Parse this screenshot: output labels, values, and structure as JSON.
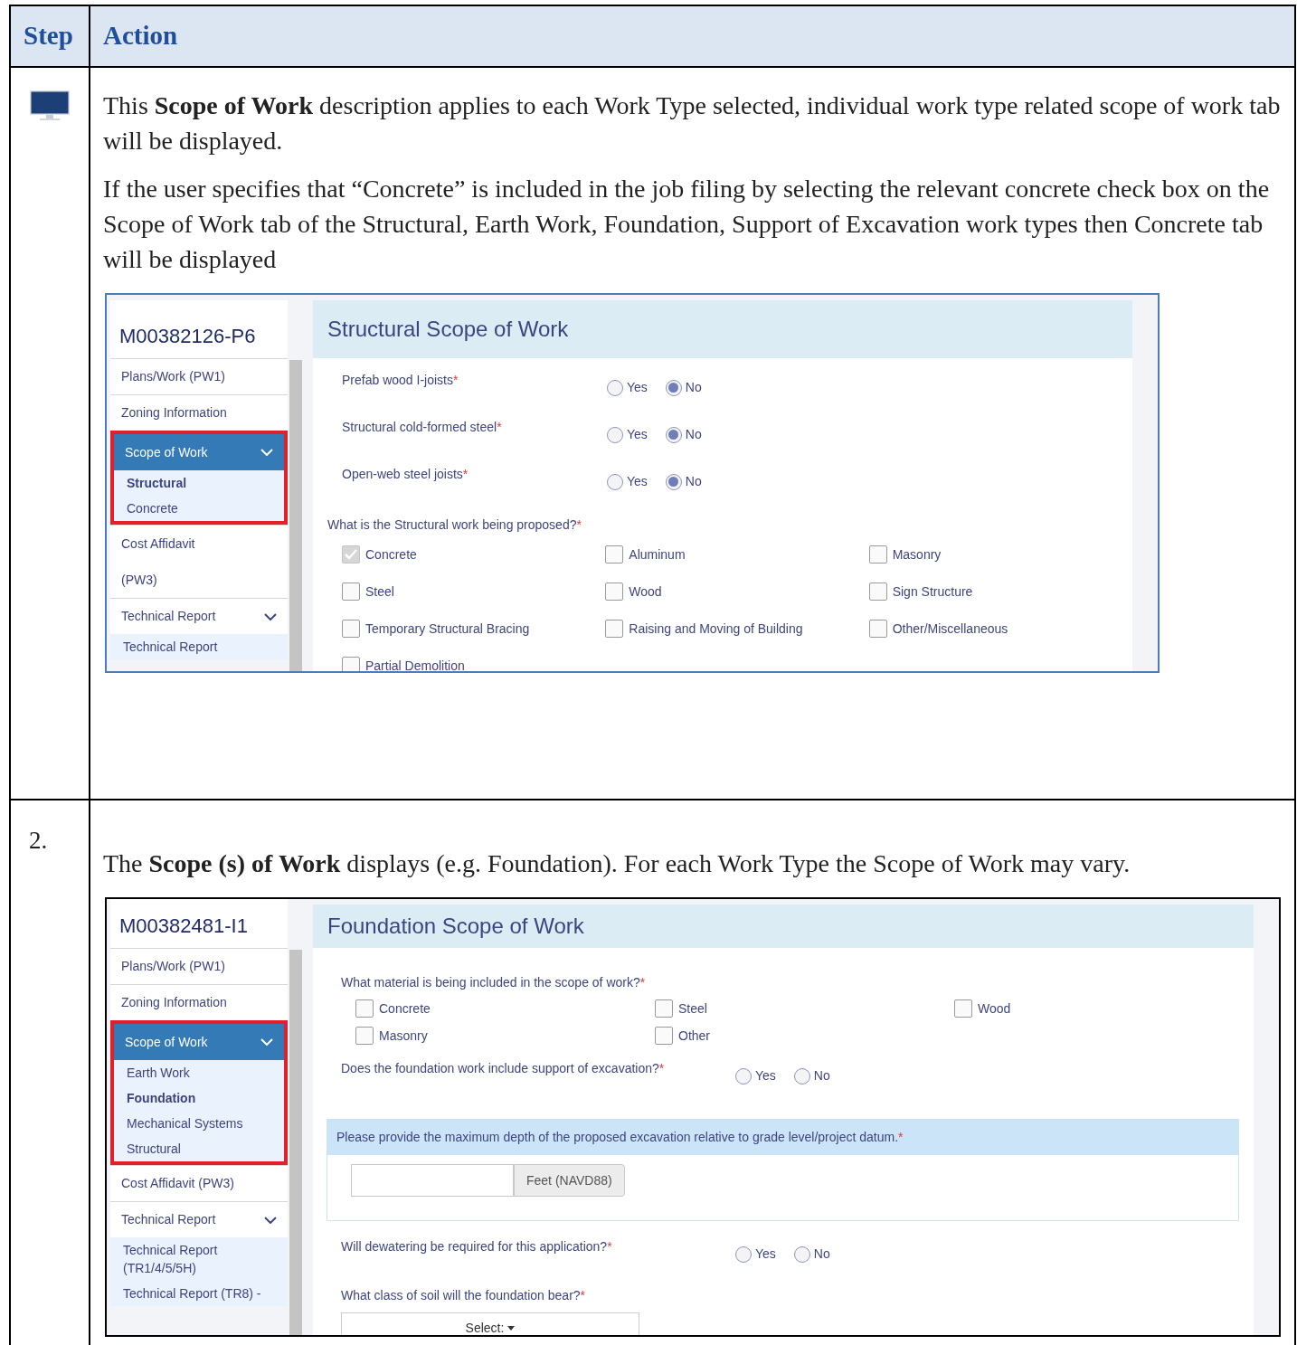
{
  "table": {
    "columns": [
      "Step",
      "Action"
    ],
    "rows": [
      {
        "paragraphs": [
          "This **Scope of Work** description applies to each Work Type selected, individual work type related scope of work tab will be displayed.",
          "If the user specifies that “Concrete” is included in the job filing by selecting the relevant concrete check box on the Scope of Work tab of the Structural, Earth Work, Foundation, Support of Excavation work types then Concrete tab will be displayed"
        ],
        "screenshot": {
          "record": "M00382126-P6",
          "nav": [
            {
              "lines": [
                "Plans/Work (PW1)"
              ],
              "selected": false,
              "expanded": false,
              "highlighted": false
            },
            {
              "lines": [
                "Zoning Information"
              ],
              "selected": false,
              "expanded": false,
              "highlighted": false
            },
            {
              "lines": [
                "Scope of Work"
              ],
              "selected": true,
              "expanded": true,
              "highlighted": true,
              "children": [
                {
                  "lines": [
                    "Structural"
                  ],
                  "selected": true
                },
                {
                  "lines": [
                    "Concrete"
                  ],
                  "selected": false
                }
              ]
            },
            {
              "lines": [
                "Cost Affidavit",
                "(PW3)"
              ],
              "selected": false,
              "expanded": false,
              "highlighted": false
            },
            {
              "lines": [
                "Technical Report"
              ],
              "selected": false,
              "expanded": true,
              "highlighted": false,
              "children": [
                {
                  "lines": [
                    "Technical Report"
                  ],
                  "selected": false
                }
              ]
            }
          ],
          "form": {
            "title": "Structural Scope of Work",
            "fields": [
              {
                "kind": "radio",
                "label": "Prefab wood I-joists",
                "mark": "*",
                "options": [
                  {
                    "label": "Yes",
                    "selected": false
                  },
                  {
                    "label": "No",
                    "selected": true
                  }
                ]
              },
              {
                "kind": "radio",
                "label": "Structural cold-formed steel",
                "mark": "*",
                "options": [
                  {
                    "label": "Yes",
                    "selected": false
                  },
                  {
                    "label": "No",
                    "selected": true
                  }
                ]
              },
              {
                "kind": "radio",
                "label": "Open-web steel joists",
                "mark": "*",
                "options": [
                  {
                    "label": "Yes",
                    "selected": false
                  },
                  {
                    "label": "No",
                    "selected": true
                  }
                ]
              },
              {
                "kind": "checks",
                "label": "What is the Structural work being proposed?",
                "mark": "*",
                "options": [
                  {
                    "label": "Concrete",
                    "checked": true
                  },
                  {
                    "label": "Aluminum",
                    "checked": false
                  },
                  {
                    "label": "Masonry",
                    "checked": false
                  },
                  {
                    "label": "Steel",
                    "checked": false
                  },
                  {
                    "label": "Wood",
                    "checked": false
                  },
                  {
                    "label": "Sign Structure",
                    "checked": false
                  },
                  {
                    "label": "Temporary Structural Bracing",
                    "checked": false
                  },
                  {
                    "label": "Raising and Moving of Building",
                    "checked": false
                  },
                  {
                    "label": "Other/Miscellaneous",
                    "checked": false
                  },
                  {
                    "label": "Partial Demolition",
                    "checked": false
                  }
                ]
              }
            ]
          }
        }
      },
      {
        "step": "2.",
        "paragraphs": [
          "The **Scope (s) of Work** displays (e.g. Foundation). For each Work Type the Scope of Work may vary."
        ],
        "screenshot": {
          "record": "M00382481-I1",
          "nav": [
            {
              "lines": [
                "Plans/Work (PW1)"
              ],
              "selected": false,
              "expanded": false,
              "highlighted": false
            },
            {
              "lines": [
                "Zoning Information"
              ],
              "selected": false,
              "expanded": false,
              "highlighted": false
            },
            {
              "lines": [
                "Scope of Work"
              ],
              "selected": true,
              "expanded": true,
              "highlighted": true,
              "children": [
                {
                  "lines": [
                    "Earth Work"
                  ],
                  "selected": false
                },
                {
                  "lines": [
                    "Foundation"
                  ],
                  "selected": true
                },
                {
                  "lines": [
                    "Mechanical Systems"
                  ],
                  "selected": false
                },
                {
                  "lines": [
                    "Structural"
                  ],
                  "selected": false
                }
              ]
            },
            {
              "lines": [
                "Cost Affidavit (PW3)"
              ],
              "selected": false,
              "expanded": false,
              "highlighted": false
            },
            {
              "lines": [
                "Technical Report"
              ],
              "selected": false,
              "expanded": true,
              "highlighted": false,
              "children": [
                {
                  "lines": [
                    "Technical Report",
                    "(TR1/4/5/5H)"
                  ],
                  "selected": false
                },
                {
                  "lines": [
                    "Technical Report (TR8) -"
                  ],
                  "selected": false
                }
              ]
            }
          ],
          "form": {
            "title": "Foundation Scope of Work",
            "fields": [
              {
                "kind": "checks",
                "label": "What material is being included in the scope of work?",
                "mark": "*",
                "options": [
                  {
                    "label": "Concrete",
                    "checked": false
                  },
                  {
                    "label": "Steel",
                    "checked": false
                  },
                  {
                    "label": "Wood",
                    "checked": false
                  },
                  {
                    "label": "Masonry",
                    "checked": false
                  },
                  {
                    "label": "Other",
                    "checked": false
                  }
                ]
              },
              {
                "kind": "radio",
                "label": "Does the foundation work include support of excavation?",
                "mark": "*",
                "options": [
                  {
                    "label": "Yes",
                    "selected": false
                  },
                  {
                    "label": "No",
                    "selected": false
                  }
                ]
              },
              {
                "kind": "panel",
                "label": "Please provide the maximum depth of the proposed excavation relative to grade level/project datum.",
                "mark": "*",
                "unit": "Feet (NAVD88)"
              },
              {
                "kind": "radio",
                "label": "Will dewatering be required for this application?",
                "mark": "*",
                "options": [
                  {
                    "label": "Yes",
                    "selected": false
                  },
                  {
                    "label": "No",
                    "selected": false
                  }
                ]
              },
              {
                "kind": "select",
                "label": "What class of soil will the foundation bear?",
                "mark": "*",
                "value": "Select:"
              }
            ]
          }
        }
      }
    ]
  }
}
